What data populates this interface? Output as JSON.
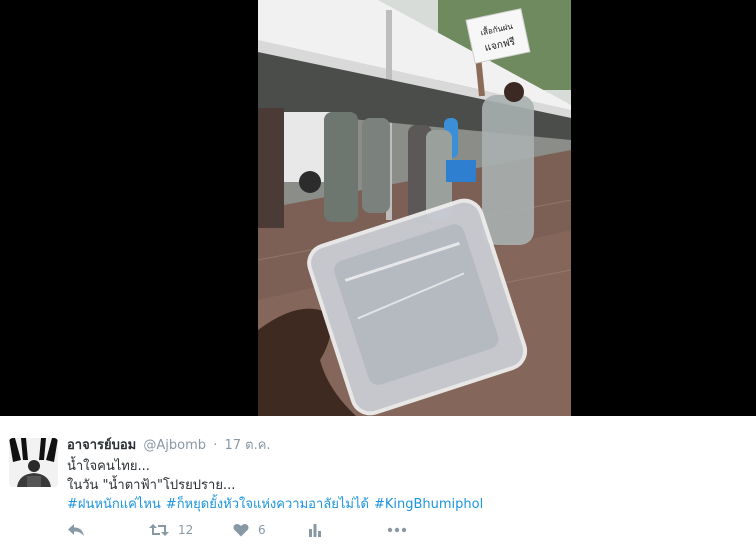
{
  "tweet": {
    "display_name": "อาจารย์บอม",
    "handle": "@Ajbomb",
    "separator": "·",
    "timestamp": "17 ต.ค.",
    "lines": [
      "น้ำใจคนไทย...",
      "ในวัน \"น้ำตาฟ้า\"โปรยปราย..."
    ],
    "hashtags": [
      "#ฝนหนักแค่ไหน",
      "#ก็หยุดยั้งหัวใจแห่งความอาลัยไม่ได้",
      "#KingBhumiphol"
    ],
    "actions": {
      "retweet_count": "12",
      "like_count": "6"
    }
  },
  "photo": {
    "sign_text": [
      "เสื้อกันฝน",
      "แจกฟรี"
    ]
  },
  "icons": {
    "reply": "reply-icon",
    "retweet": "retweet-icon",
    "like": "heart-icon",
    "analytics": "analytics-icon",
    "more": "more-dots-icon"
  },
  "colors": {
    "link": "#1b95e0",
    "muted": "#8899a6",
    "text": "#292f33",
    "media_background": "#000000"
  }
}
